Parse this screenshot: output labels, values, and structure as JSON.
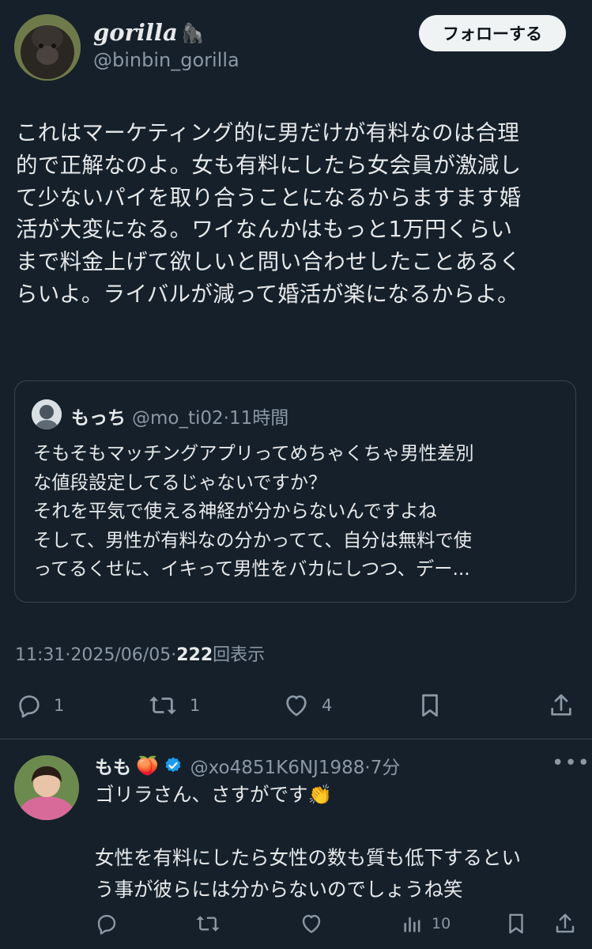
{
  "tweet": {
    "display_name": "gorilla",
    "name_emoji": "🦍",
    "handle": "@binbin_gorilla",
    "follow_label": "フォローする",
    "text": "これはマーケティング的に男だけが有料なのは合理\n的で正解なのよ。女も有料にしたら女会員が激減し\nて少ないパイを取り合うことになるからますます婚\n活が大変になる。ワイなんかはもっと1万円くらい\nまで料金上げて欲しいと問い合わせしたことあるく\nらいよ。ライバルが減って婚活が楽になるからよ。",
    "time": "11:31",
    "date": "2025/06/05",
    "views": "222",
    "views_label": "回表示",
    "sep": " · ",
    "counts": {
      "replies": "1",
      "retweets": "1",
      "likes": "4"
    }
  },
  "quote": {
    "name": "もっち",
    "handle": "@mo_ti02",
    "time": "11時間",
    "sep": "·",
    "text": "そもそもマッチングアプリってめちゃくちゃ男性差別\nな値段設定してるじゃないですか？\nそれを平気で使える神経が分からないんですよね\nそして、男性が有料なの分かってて、自分は無料で使\nってるくせに、イキって男性をバカにしつつ、デー..."
  },
  "reply": {
    "name": "もも",
    "name_emoji": "🍑",
    "handle": "@xo4851K6NJ1988",
    "time": "7分",
    "sep": "·",
    "more": "•••",
    "text_line1": "ゴリラさん、さすがです👏",
    "text_rest": "\n\n女性を有料にしたら女性の数も質も低下するとい\nう事が彼らには分からないのでしょうね笑",
    "views": "10"
  },
  "colors": {
    "background": "#15202b",
    "text": "#e7e9ea",
    "muted": "#8b98a5",
    "border": "#38444d",
    "verified": "#1d9bf0"
  },
  "icons": [
    "reply-icon",
    "retweet-icon",
    "like-icon",
    "bookmark-icon",
    "share-icon",
    "verified-badge-icon",
    "analytics-icon",
    "more-icon"
  ]
}
